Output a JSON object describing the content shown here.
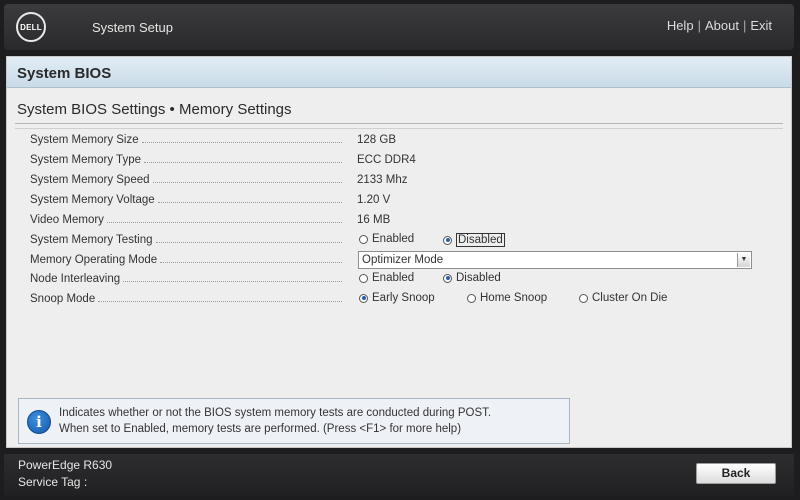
{
  "header": {
    "logo_text": "DELL",
    "app_title": "System Setup",
    "links": {
      "help": "Help",
      "about": "About",
      "exit": "Exit",
      "separator": "|"
    }
  },
  "section": {
    "title": "System BIOS",
    "page_title": "System BIOS Settings • Memory Settings"
  },
  "settings": [
    {
      "label": "System Memory Size",
      "value": "128 GB"
    },
    {
      "label": "System Memory Type",
      "value": "ECC DDR4"
    },
    {
      "label": "System Memory Speed",
      "value": "2133 Mhz"
    },
    {
      "label": "System Memory Voltage",
      "value": "1.20 V"
    },
    {
      "label": "Video Memory",
      "value": "16 MB"
    },
    {
      "label": "System Memory Testing",
      "options": [
        "Enabled",
        "Disabled"
      ],
      "selected": "Disabled"
    },
    {
      "label": "Memory Operating Mode",
      "value": "Optimizer Mode"
    },
    {
      "label": "Node Interleaving",
      "options": [
        "Enabled",
        "Disabled"
      ],
      "selected": "Disabled"
    },
    {
      "label": "Snoop Mode",
      "options": [
        "Early Snoop",
        "Home Snoop",
        "Cluster On Die"
      ],
      "selected": "Early Snoop"
    }
  ],
  "help": {
    "icon": "info-icon",
    "line1": "Indicates whether or not the BIOS system memory tests are conducted during POST.",
    "line2": "When set to Enabled, memory tests are performed. (Press <F1> for more help)"
  },
  "footer": {
    "model": "PowerEdge R630",
    "service_tag_label": "Service Tag :",
    "back_label": "Back"
  },
  "colors": {
    "header_bg": "#2f2f31",
    "panel_bg": "#eeeeee",
    "section_header_bg": "#d3e3ef",
    "radio_selected": "#2b5fa8",
    "info_icon": "#1f6fc6"
  }
}
